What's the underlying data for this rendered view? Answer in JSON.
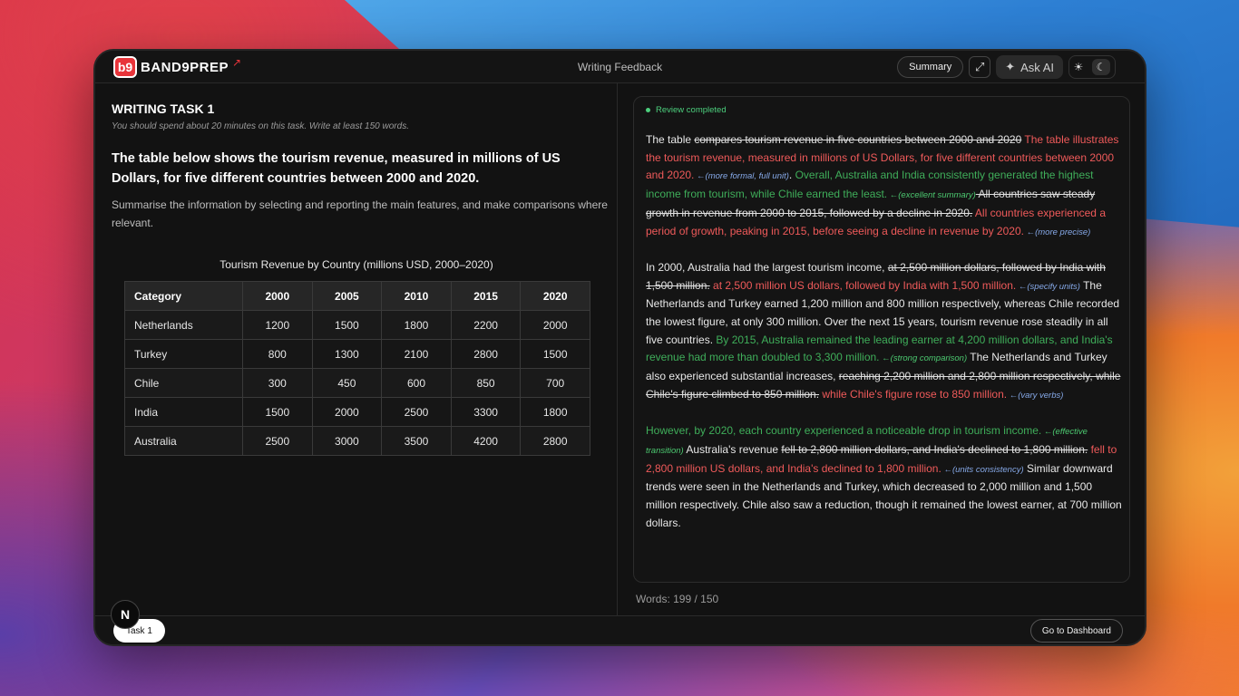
{
  "app": {
    "logo_text": "BAND9PREP",
    "logo_badge": "b9",
    "title": "Writing Feedback"
  },
  "toolbar": {
    "summary_label": "Summary",
    "ask_ai_label": "Ask AI"
  },
  "task": {
    "title": "WRITING TASK 1",
    "subtitle": "You should spend about 20 minutes on this task. Write at least 150 words.",
    "prompt": "The table below shows the tourism revenue, measured in millions of US Dollars, for five different countries between 2000 and 2020.",
    "instruction": "Summarise the information by selecting and reporting the main features, and make comparisons where relevant."
  },
  "table": {
    "caption": "Tourism Revenue by Country (millions USD, 2000–2020)",
    "headers": [
      "Category",
      "2000",
      "2005",
      "2010",
      "2015",
      "2020"
    ],
    "rows": [
      [
        "Netherlands",
        "1200",
        "1500",
        "1800",
        "2200",
        "2000"
      ],
      [
        "Turkey",
        "800",
        "1300",
        "2100",
        "2800",
        "1500"
      ],
      [
        "Chile",
        "300",
        "450",
        "600",
        "850",
        "700"
      ],
      [
        "India",
        "1500",
        "2000",
        "2500",
        "3300",
        "1800"
      ],
      [
        "Australia",
        "2500",
        "3000",
        "3500",
        "4200",
        "2800"
      ]
    ]
  },
  "review": {
    "status": "Review completed",
    "p1": {
      "t1": "The table ",
      "d1": "compares tourism revenue in five countries between 2000 and 2020",
      "a1": " The table illustrates the tourism revenue, measured in millions of US Dollars, for five different countries between 2000 and 2020.",
      "n1": " ←(more formal, full unit)",
      "t2": ". ",
      "g1": "Overall, Australia and India consistently generated the highest income from tourism, while Chile earned the least.",
      "n2": " ←(excellent summary)",
      "d2": " All countries saw steady growth in revenue from 2000 to 2015, followed by a decline in 2020.",
      "a2": " All countries experienced a period of growth, peaking in 2015, before seeing a decline in revenue by 2020.",
      "n3": " ←(more precise)"
    },
    "p2": {
      "t1": "In 2000, Australia had the largest tourism income, ",
      "d1": "at 2,500 million dollars, followed by India with 1,500 million.",
      "a1": " at 2,500 million US dollars, followed by India with 1,500 million.",
      "n1": " ←(specify units)",
      "t2": " The Netherlands and Turkey earned 1,200 million and 800 million respectively, whereas Chile recorded the lowest figure, at only 300 million. Over the next 15 years, tourism revenue rose steadily in all five countries. ",
      "g1": "By 2015, Australia remained the leading earner at 4,200 million dollars, and India's revenue had more than doubled to 3,300 million.",
      "n2": " ←(strong comparison)",
      "t3": " The Netherlands and Turkey also experienced substantial increases, ",
      "d2": "reaching 2,200 million and 2,800 million respectively, while Chile's figure climbed to 850 million.",
      "a2": " while Chile's figure rose to 850 million.",
      "n3": " ←(vary verbs)"
    },
    "p3": {
      "g1": "However, by 2020, each country experienced a noticeable drop in tourism income.",
      "n1": " ←(effective transition)",
      "t1": " Australia's revenue ",
      "d1": "fell to 2,800 million dollars, and India's declined to 1,800 million.",
      "a1": " fell to 2,800 million US dollars, and India's declined to 1,800 million.",
      "n2": " ←(units consistency)",
      "t2": " Similar downward trends were seen in the Netherlands and Turkey, which decreased to 2,000 million and 1,500 million respectively. Chile also saw a reduction, though it remained the lowest earner, at 700 million dollars."
    },
    "word_count": "Words: 199 / 150"
  },
  "footer": {
    "task_tab": "Task 1",
    "dashboard_label": "Go to Dashboard",
    "n_badge": "N"
  }
}
